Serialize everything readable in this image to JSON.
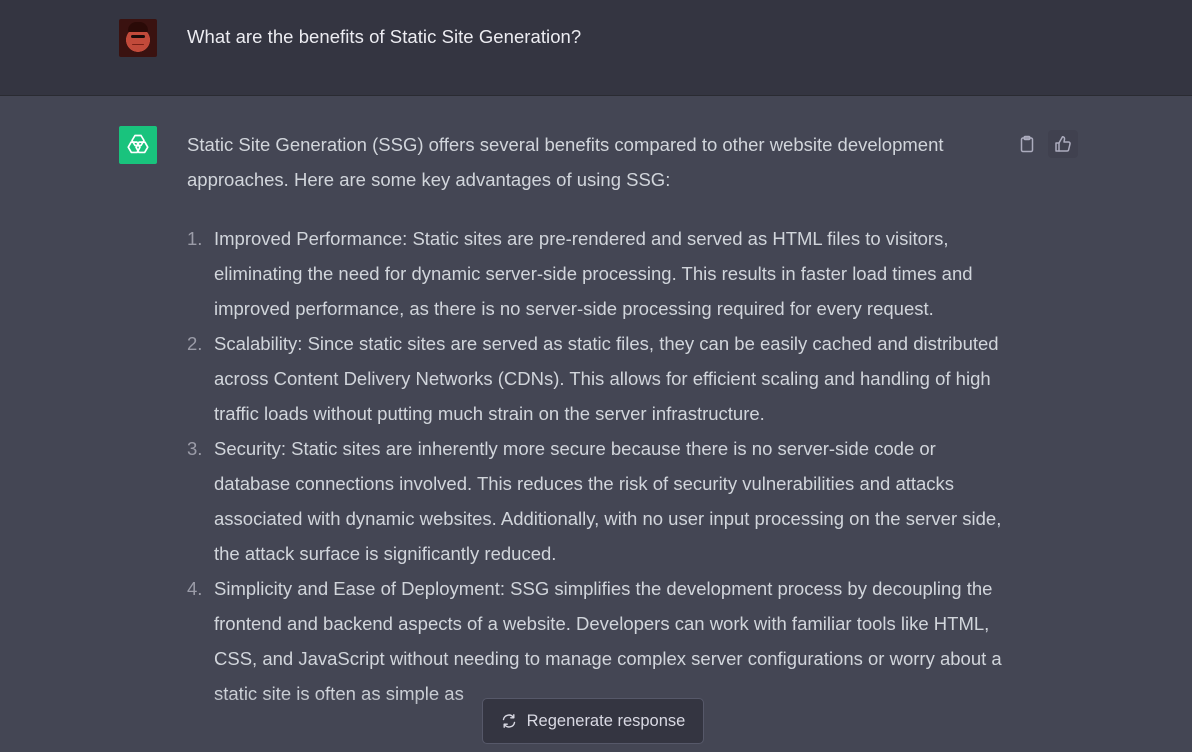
{
  "user_message": {
    "text": "What are the benefits of Static Site Generation?"
  },
  "assistant_message": {
    "intro": "Static Site Generation (SSG) offers several benefits compared to other website development approaches. Here are some key advantages of using SSG:",
    "items": [
      {
        "number": "1.",
        "text": "Improved Performance: Static sites are pre-rendered and served as HTML files to visitors, eliminating the need for dynamic server-side processing. This results in faster load times and improved performance, as there is no server-side processing required for every request."
      },
      {
        "number": "2.",
        "text": "Scalability: Since static sites are served as static files, they can be easily cached and distributed across Content Delivery Networks (CDNs). This allows for efficient scaling and handling of high traffic loads without putting much strain on the server infrastructure."
      },
      {
        "number": "3.",
        "text": "Security: Static sites are inherently more secure because there is no server-side code or database connections involved. This reduces the risk of security vulnerabilities and attacks associated with dynamic websites. Additionally, with no user input processing on the server side, the attack surface is significantly reduced."
      },
      {
        "number": "4.",
        "text": "Simplicity and Ease of Deployment: SSG simplifies the development process by decoupling the frontend and backend aspects of a website. Developers can work with familiar tools like HTML, CSS, and JavaScript without needing to manage complex server configurations or worry about a static site is often as simple as"
      }
    ]
  },
  "actions": {
    "copy_icon": "clipboard-icon",
    "thumbs_up_icon": "thumbs-up-icon"
  },
  "regenerate": {
    "label": "Regenerate response",
    "icon": "refresh-icon"
  },
  "colors": {
    "page_background": "#444654",
    "user_row_background": "#343541",
    "openai_green": "#19c37d",
    "text": "#d1d5db"
  }
}
